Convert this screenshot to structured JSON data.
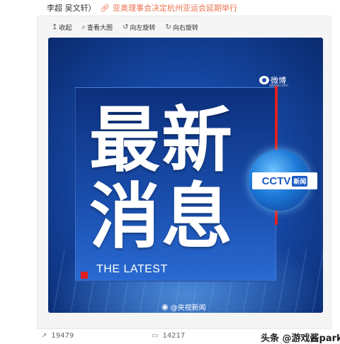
{
  "post": {
    "authors_tail": "李超 吴文轩）",
    "link_icon": "link-icon",
    "link_text": "亚奥理事会决定杭州亚运会延期举行"
  },
  "toolbar": {
    "items": [
      {
        "icon": "arrow-up-icon",
        "label": "收起"
      },
      {
        "icon": "zoom-icon",
        "label": "查看大图"
      },
      {
        "icon": "rotate-left-icon",
        "label": "向左旋转"
      },
      {
        "icon": "rotate-right-icon",
        "label": "向右旋转"
      }
    ]
  },
  "image": {
    "weibo_logo_text": "微博",
    "weibo_domain": "weibo.com",
    "headline_line1": "最新",
    "headline_line2": "消息",
    "subtitle": "THE LATEST",
    "cctv_text": "CCTV",
    "cctv_news": "新闻",
    "watermark": "@央视新闻"
  },
  "stats": {
    "forward_count": "19479",
    "comment_count": "14217"
  },
  "page_watermark": "头条 @游戏酱park",
  "colors": {
    "link": "#eb7350",
    "accent_red": "#e0201e",
    "bg_blue": "#174aa8"
  }
}
